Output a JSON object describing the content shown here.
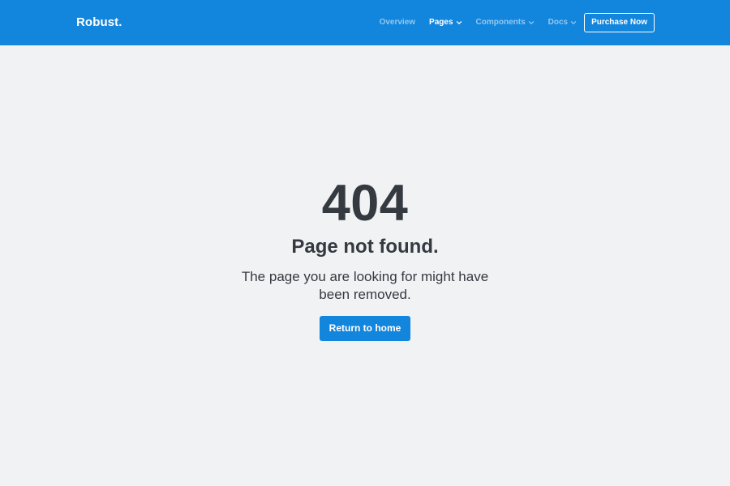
{
  "navbar": {
    "brand": "Robust.",
    "items": [
      {
        "label": "Overview",
        "dropdown": false,
        "active": false
      },
      {
        "label": "Pages",
        "dropdown": true,
        "active": true
      },
      {
        "label": "Components",
        "dropdown": true,
        "active": false
      },
      {
        "label": "Docs",
        "dropdown": true,
        "active": false
      }
    ],
    "purchase_label": "Purchase Now"
  },
  "error": {
    "code": "404",
    "title": "Page not found.",
    "message": "The page you are looking for might have been removed.",
    "button_label": "Return to home"
  },
  "colors": {
    "primary": "#1285dc",
    "background": "#f1f2f4",
    "text": "#343a40"
  }
}
